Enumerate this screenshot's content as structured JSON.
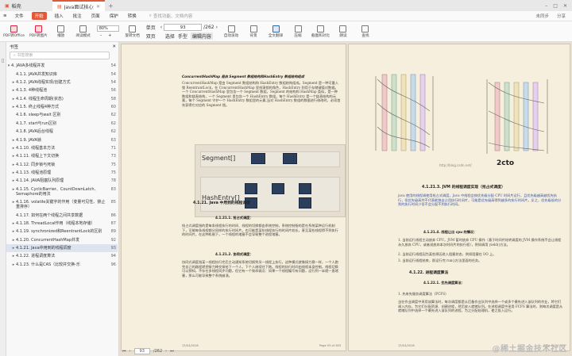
{
  "tabs": {
    "home": "稻壳",
    "active": "Java面试核心知...--V5终极版.pdf",
    "plus": "+"
  },
  "menu": {
    "items": [
      "文件",
      "开始",
      "插入",
      "批注",
      "页面",
      "保护",
      "转换"
    ],
    "active_index": 1,
    "search_placeholder": "查找功能、文档内容",
    "right": [
      "未同步",
      "分享"
    ]
  },
  "toolbar": {
    "items": [
      {
        "label": "PDF转Office",
        "icon": "pdf-to-office-icon"
      },
      {
        "label": "PDF转图片",
        "icon": "pdf-to-image-icon"
      },
      {
        "label": "播放",
        "icon": "play-icon"
      },
      {
        "label": "阅读模式",
        "icon": "read-mode-icon"
      }
    ],
    "zoom": "80%",
    "zoom_in": "+",
    "zoom_out": "–",
    "items2": [
      {
        "label": "旋转文档",
        "icon": "rotate-icon"
      },
      {
        "label": "单页",
        "icon": "single-page-icon"
      },
      {
        "label": "双页",
        "icon": "double-page-icon"
      },
      {
        "label": "连续阅读",
        "icon": "continuous-icon"
      }
    ],
    "page_value": "93",
    "page_total": "/262",
    "tools": [
      "选择",
      "手型",
      "编辑内容"
    ],
    "items3": [
      {
        "label": "自动滚动",
        "icon": "auto-scroll-icon"
      },
      {
        "label": "背景",
        "icon": "background-icon"
      },
      {
        "label": "全文翻译",
        "icon": "translate-icon"
      },
      {
        "label": "压缩",
        "icon": "compress-icon"
      },
      {
        "label": "截图和对比",
        "icon": "screenshot-icon"
      },
      {
        "label": "朗读",
        "icon": "read-aloud-icon"
      },
      {
        "label": "查找",
        "icon": "find-icon"
      }
    ]
  },
  "sidebar": {
    "title": "书签",
    "search_placeholder": "书签搜索",
    "items": [
      {
        "label": "4. JAVA多线程并发",
        "page": "54",
        "level": 0,
        "arrow": "▾"
      },
      {
        "label": "4.1.1. JAVA并发知识库",
        "page": "54",
        "level": 1,
        "arrow": ""
      },
      {
        "label": "4.1.2. JAVA线程实现/创建方式",
        "page": "54",
        "level": 1,
        "arrow": "▸"
      },
      {
        "label": "4.1.3. 4种线程池",
        "page": "56",
        "level": 1,
        "arrow": "▸"
      },
      {
        "label": "4.1.4. 线程生命周期(状态)",
        "page": "58",
        "level": 1,
        "arrow": "▸"
      },
      {
        "label": "4.1.5. 终止线程4种方式",
        "page": "60",
        "level": 1,
        "arrow": "▸"
      },
      {
        "label": "4.1.6. sleep与wait 区别",
        "page": "62",
        "level": 1,
        "arrow": ""
      },
      {
        "label": "4.1.7. start与run区别",
        "page": "62",
        "level": 1,
        "arrow": ""
      },
      {
        "label": "4.1.8. JAVA后台线程",
        "page": "62",
        "level": 1,
        "arrow": ""
      },
      {
        "label": "4.1.9. JAVA锁",
        "page": "63",
        "level": 1,
        "arrow": "▸"
      },
      {
        "label": "4.1.10. 线程基本方法",
        "page": "71",
        "level": 1,
        "arrow": "▸"
      },
      {
        "label": "4.1.11. 线程上下文切换",
        "page": "73",
        "level": 1,
        "arrow": "▸"
      },
      {
        "label": "4.1.12. 同步锁与死锁",
        "page": "75",
        "level": 1,
        "arrow": "▸"
      },
      {
        "label": "4.1.13. 线程池原理",
        "page": "75",
        "level": 1,
        "arrow": "▸"
      },
      {
        "label": "4.1.14. JAVA阻塞队列原理",
        "page": "78",
        "level": 1,
        "arrow": "▸"
      },
      {
        "label": "4.1.15. CyclicBarrier、CountDownLatch、Semaphore的用法",
        "page": "83",
        "level": 1,
        "arrow": "▸"
      },
      {
        "label": "4.1.16. volatile关键字的作用（变量可见性、禁止重排序）",
        "page": "85",
        "level": 1,
        "arrow": "▸"
      },
      {
        "label": "4.1.17. 如何在两个线程之间共享数据",
        "page": "86",
        "level": 1,
        "arrow": ""
      },
      {
        "label": "4.1.18. ThreadLocal作用（线程本地存储）",
        "page": "87",
        "level": 1,
        "arrow": "▸"
      },
      {
        "label": "4.1.19. synchronized和ReentrantLock的区别",
        "page": "89",
        "level": 1,
        "arrow": "▸"
      },
      {
        "label": "4.1.20. ConcurrentHashMap并发",
        "page": "92",
        "level": 1,
        "arrow": "▸"
      },
      {
        "label": "4.1.21. Java中用到的线程调度",
        "page": "93",
        "level": 1,
        "arrow": "▸"
      },
      {
        "label": "4.1.22. 进程调度算法",
        "page": "94",
        "level": 1,
        "arrow": "▸"
      },
      {
        "label": "4.1.23. 什么是CAS（比较并交换-乐",
        "page": "96",
        "level": 1,
        "arrow": "▸"
      }
    ],
    "selected_index": 21
  },
  "page_left": {
    "heading": "ConcurrentHashMap 是由 Segment 数组结构和HashEntry 数组结构组成",
    "p1": "ConcurrentHashMap 是由 Segment 数组结构和 HashEntry 数组结构组成。Segment 是一种可重入锁 ReentrantLock，在 ConcurrentHashMap 里扮演锁的角色，HashEntry 则用于存储键值对数据。一个 ConcurrentHashMap 里包含一个 Segment 数组，Segment 的结构和 HashMap 类似，是一种数组和链表结构，一个 Segment 里包含一个 HashEntry 数组，每个 HashEntry 是一个链表结构的元素，每个 Segment 守护一个 HashEntry 数组里的元素,当对 HashEntry 数组的数据进行修改时，必须首先获得它对应的 Segment 锁。",
    "segment_label": "Segment[]",
    "hashentry_label": "HashEntry[]",
    "h_421": "4.1.21.  Java 中用到的线程调度",
    "h_4211": "4.1.21.1.   抢占式调度：",
    "p2": "抢占式调度指的是每条线程执行的时间、线程的切换都由系统控制，系统控制指的是在系统某种运行机制下，可能每条线程都分同样的执行时间片，也可能是某些线程执行的时间片较长，甚至某些线程得不到执行的时间片。在这种机制下，一个线程的堵塞不会导致整个进程堵塞。",
    "h_4212": "4.1.21.2.   协同式调度：",
    "p3": "协同式调度指某一线程执行完后主动通知系统切换到另一线程上执行，这种模式就像接力赛一样，一个人跑完自己的路程就把接力棒交接给下一个人，下个人继续往下跑。线程的执行时间由线程本身控制，线程切换可以预知，不存在多线程同步问题，但它有一个致命弱点：如果一个线程编写有问题，运行到一半就一直堵塞，那么可能导致整个系统崩溃。",
    "footer_left": "13/04/2018",
    "footer_right": "Page 93 of 283"
  },
  "page_right": {
    "fig_caption": "4.1.21.3.  JVM 的线程调度实现（抢占式调度）",
    "logo_text": "2cto",
    "url_text": "http://blog.csdn.net/",
    "p1": "java 使用的线程调使用抢占式调度，Java 中线程会按优先级分配 CPU 时间片运行，且优先级越高越优先执行，但优先级高并不代表能独自占用执行时间片，可能是优先级高得到越多的执行时间片，反之，优先级低的分到的执行时间少但不会分配不到执行时间。",
    "h_4214": "4.1.21.4.   线程让出 cpu 的情况：",
    "li1": "1.   当前运行线程主动放弃 CPU，JVM 暂时放弃 CPU 操作（基于时间片轮转调度的 JVM 操作系统不会让线程永久放弃 CPU，或者说放弃本次时间片的执行权），例如调用 yield()方法。",
    "li2": "2.   当前运行线程因为某些原因进入阻塞状态，例如阻塞在 I/O 上。",
    "li3": "3.   当前运行线程结束，即运行完 run()方法里面的任务。",
    "h_422": "4.1.22.  进程调度算法",
    "h_4221": "4.1.22.1.   优先调度算法：",
    "li4": "1.   先来先服务调度算法（FCFS）",
    "p2": "当在作业调度中采用该算法时，每次调度都是从后备作业队列中选择一个或多个最先进入该队列的作业，将它们调入内存，为它们分配资源、创建进程，然后放入就绪队列。在进程调度中采用 FCFS 算法时，则每次调度是从就绪队列中选择一个最先进入该队列的进程，为之分配处理机，使之投入运行。",
    "footer_left": "13/04/2018",
    "footer_right": "Page 94 of 283"
  },
  "status": {
    "page": "93",
    "total": "/262",
    "watermark": "@稀土掘金技术社区"
  },
  "colors": {
    "accent": "#e05a3a",
    "page_bg": "#f7efdd",
    "link": "#3355aa",
    "segment_box": "#2b3f5c"
  }
}
